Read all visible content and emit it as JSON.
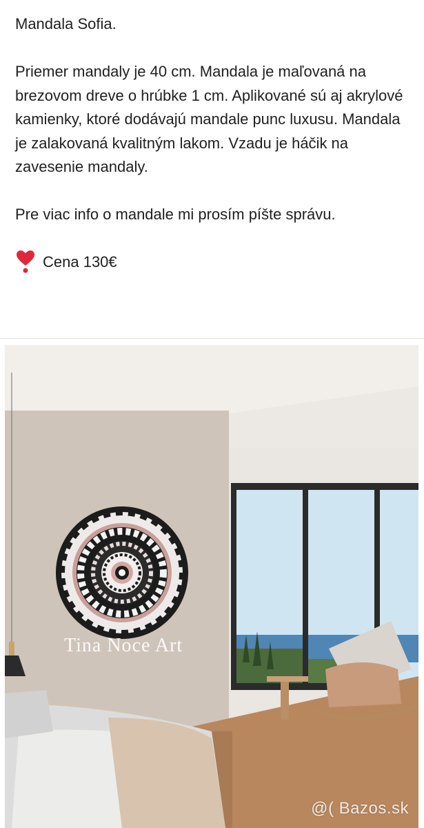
{
  "post": {
    "title": "Mandala Sofia.",
    "description": "Priemer mandaly je 40 cm. Mandala je maľovaná na brezovom dreve o hrúbke 1 cm. Aplikované sú aj akrylové kamienky, ktoré dodávajú mandale punc luxusu. Mandala je zalakovaná kvalitným lakom. Vzadu je háčik na zavesenie mandaly.",
    "contact": "Pre viac info o mandale mi prosím píšte správu.",
    "price_label": "Cena 130€",
    "price_icon": "heart-exclamation-icon"
  },
  "photo": {
    "artist_signature": "Tina Noce Art",
    "watermark": "@( Bazos.sk"
  },
  "colors": {
    "heart": "#e0283d",
    "wall": "#cfc4b9",
    "ceiling": "#f2efeb",
    "floor": "#b9875e",
    "sky": "#cfe6f2",
    "sea": "#4f86b5"
  }
}
